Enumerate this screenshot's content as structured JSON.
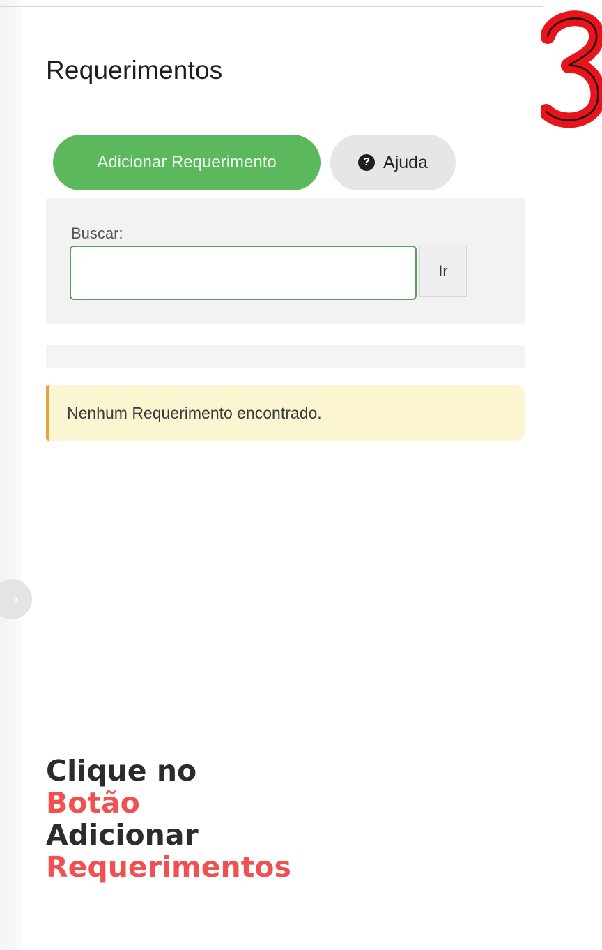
{
  "step_number": "3",
  "page": {
    "title": "Requerimentos"
  },
  "actions": {
    "add_label": "Adicionar Requerimento",
    "help_label": "Ajuda",
    "help_icon": "question-circle-icon"
  },
  "search": {
    "label": "Buscar:",
    "value": "",
    "placeholder": "",
    "go_label": "Ir"
  },
  "alert": {
    "message": "Nenhum Requerimento encontrado."
  },
  "instruction": {
    "line1": "Clique no",
    "line2": "Botão",
    "line3": "Adicionar",
    "line4": "Requerimentos"
  },
  "colors": {
    "primary_button": "#5cb85c",
    "alert_background": "#fcf5d2",
    "alert_border": "#e6a23c",
    "annotation_red": "#f05050",
    "step_number_red": "#e8141c"
  }
}
